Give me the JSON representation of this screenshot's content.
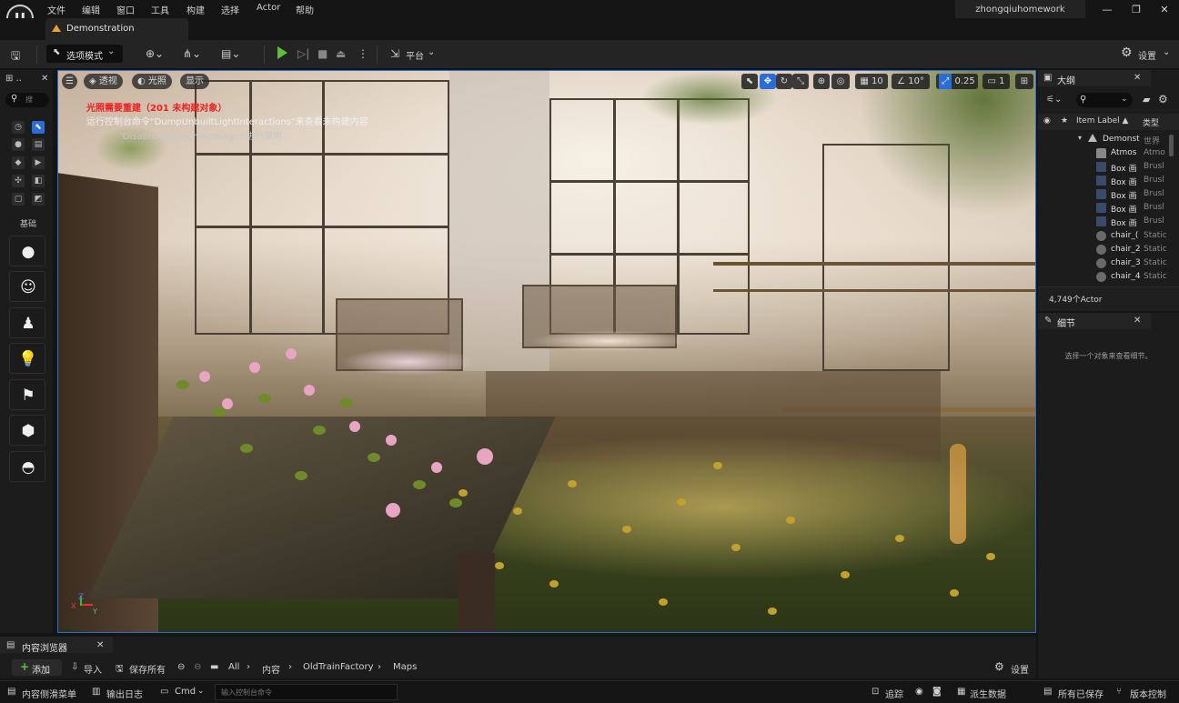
{
  "menu": [
    "文件",
    "编辑",
    "窗口",
    "工具",
    "构建",
    "选择",
    "Actor",
    "帮助"
  ],
  "user": "zhongqiuhomework",
  "window_controls": {
    "minimize": "—",
    "restore": "❐",
    "close": "✕"
  },
  "document_tab": "Demonstration",
  "toolbar": {
    "mode": "选项模式",
    "platform": "平台",
    "settings": "设置"
  },
  "left_panel": {
    "search_placeholder": "搜",
    "section_label": "基础"
  },
  "viewport": {
    "menu_btn": "☰",
    "view_mode": "透视",
    "lighting": "光照",
    "show": "显示",
    "warning_title": "光照需要重建（201 未构建对象）",
    "warning_line1": "运行控制台命令\"DumpUnbuiltLightInteractions\"来查看未构建内容",
    "warning_line2": "'DisableAllScreenMessages'进行禁用",
    "grid_snap": "10",
    "rotation_snap": "10°",
    "scale_snap": "0.25",
    "camera_speed": "1",
    "axis_x": "X",
    "axis_y": "Y",
    "axis_z": "Z"
  },
  "outliner": {
    "title": "大纲",
    "col_label": "Item Label ▲",
    "col_type": "类型",
    "rows": [
      {
        "name": "Demonst",
        "type": "世界",
        "icon": "world"
      },
      {
        "name": "Atmos",
        "type": "Atmo",
        "icon": "atmos"
      },
      {
        "name": "Box 画",
        "type": "Brusl",
        "icon": "box"
      },
      {
        "name": "Box 画",
        "type": "Brusl",
        "icon": "box"
      },
      {
        "name": "Box 画",
        "type": "Brusl",
        "icon": "box"
      },
      {
        "name": "Box 画",
        "type": "Brusl",
        "icon": "box"
      },
      {
        "name": "Box 画",
        "type": "Brusl",
        "icon": "box"
      },
      {
        "name": "chair_(",
        "type": "Static",
        "icon": "mesh"
      },
      {
        "name": "chair_2",
        "type": "Static",
        "icon": "mesh"
      },
      {
        "name": "chair_3",
        "type": "Static",
        "icon": "mesh"
      },
      {
        "name": "chair_4",
        "type": "Static",
        "icon": "mesh"
      }
    ],
    "count": "4,749个Actor"
  },
  "details": {
    "title": "细节",
    "empty_message": "选择一个对象来查看细节。"
  },
  "content_browser": {
    "title": "内容浏览器",
    "add": "添加",
    "import": "导入",
    "save_all": "保存所有",
    "breadcrumbs": [
      "All",
      "内容",
      "OldTrainFactory",
      "Maps"
    ],
    "settings": "设置"
  },
  "status_bar": {
    "content_drawer": "内容侧滑菜单",
    "output_log": "输出日志",
    "cmd": "Cmd",
    "cmd_placeholder": "输入控制台命令",
    "trace": "追踪",
    "derived_data": "派生数据",
    "all_saved": "所有已保存",
    "version_control": "版本控制"
  },
  "colors": {
    "accent_blue": "#2a6cd8",
    "play_green": "#5fc235",
    "warning_red": "#ee2020"
  }
}
